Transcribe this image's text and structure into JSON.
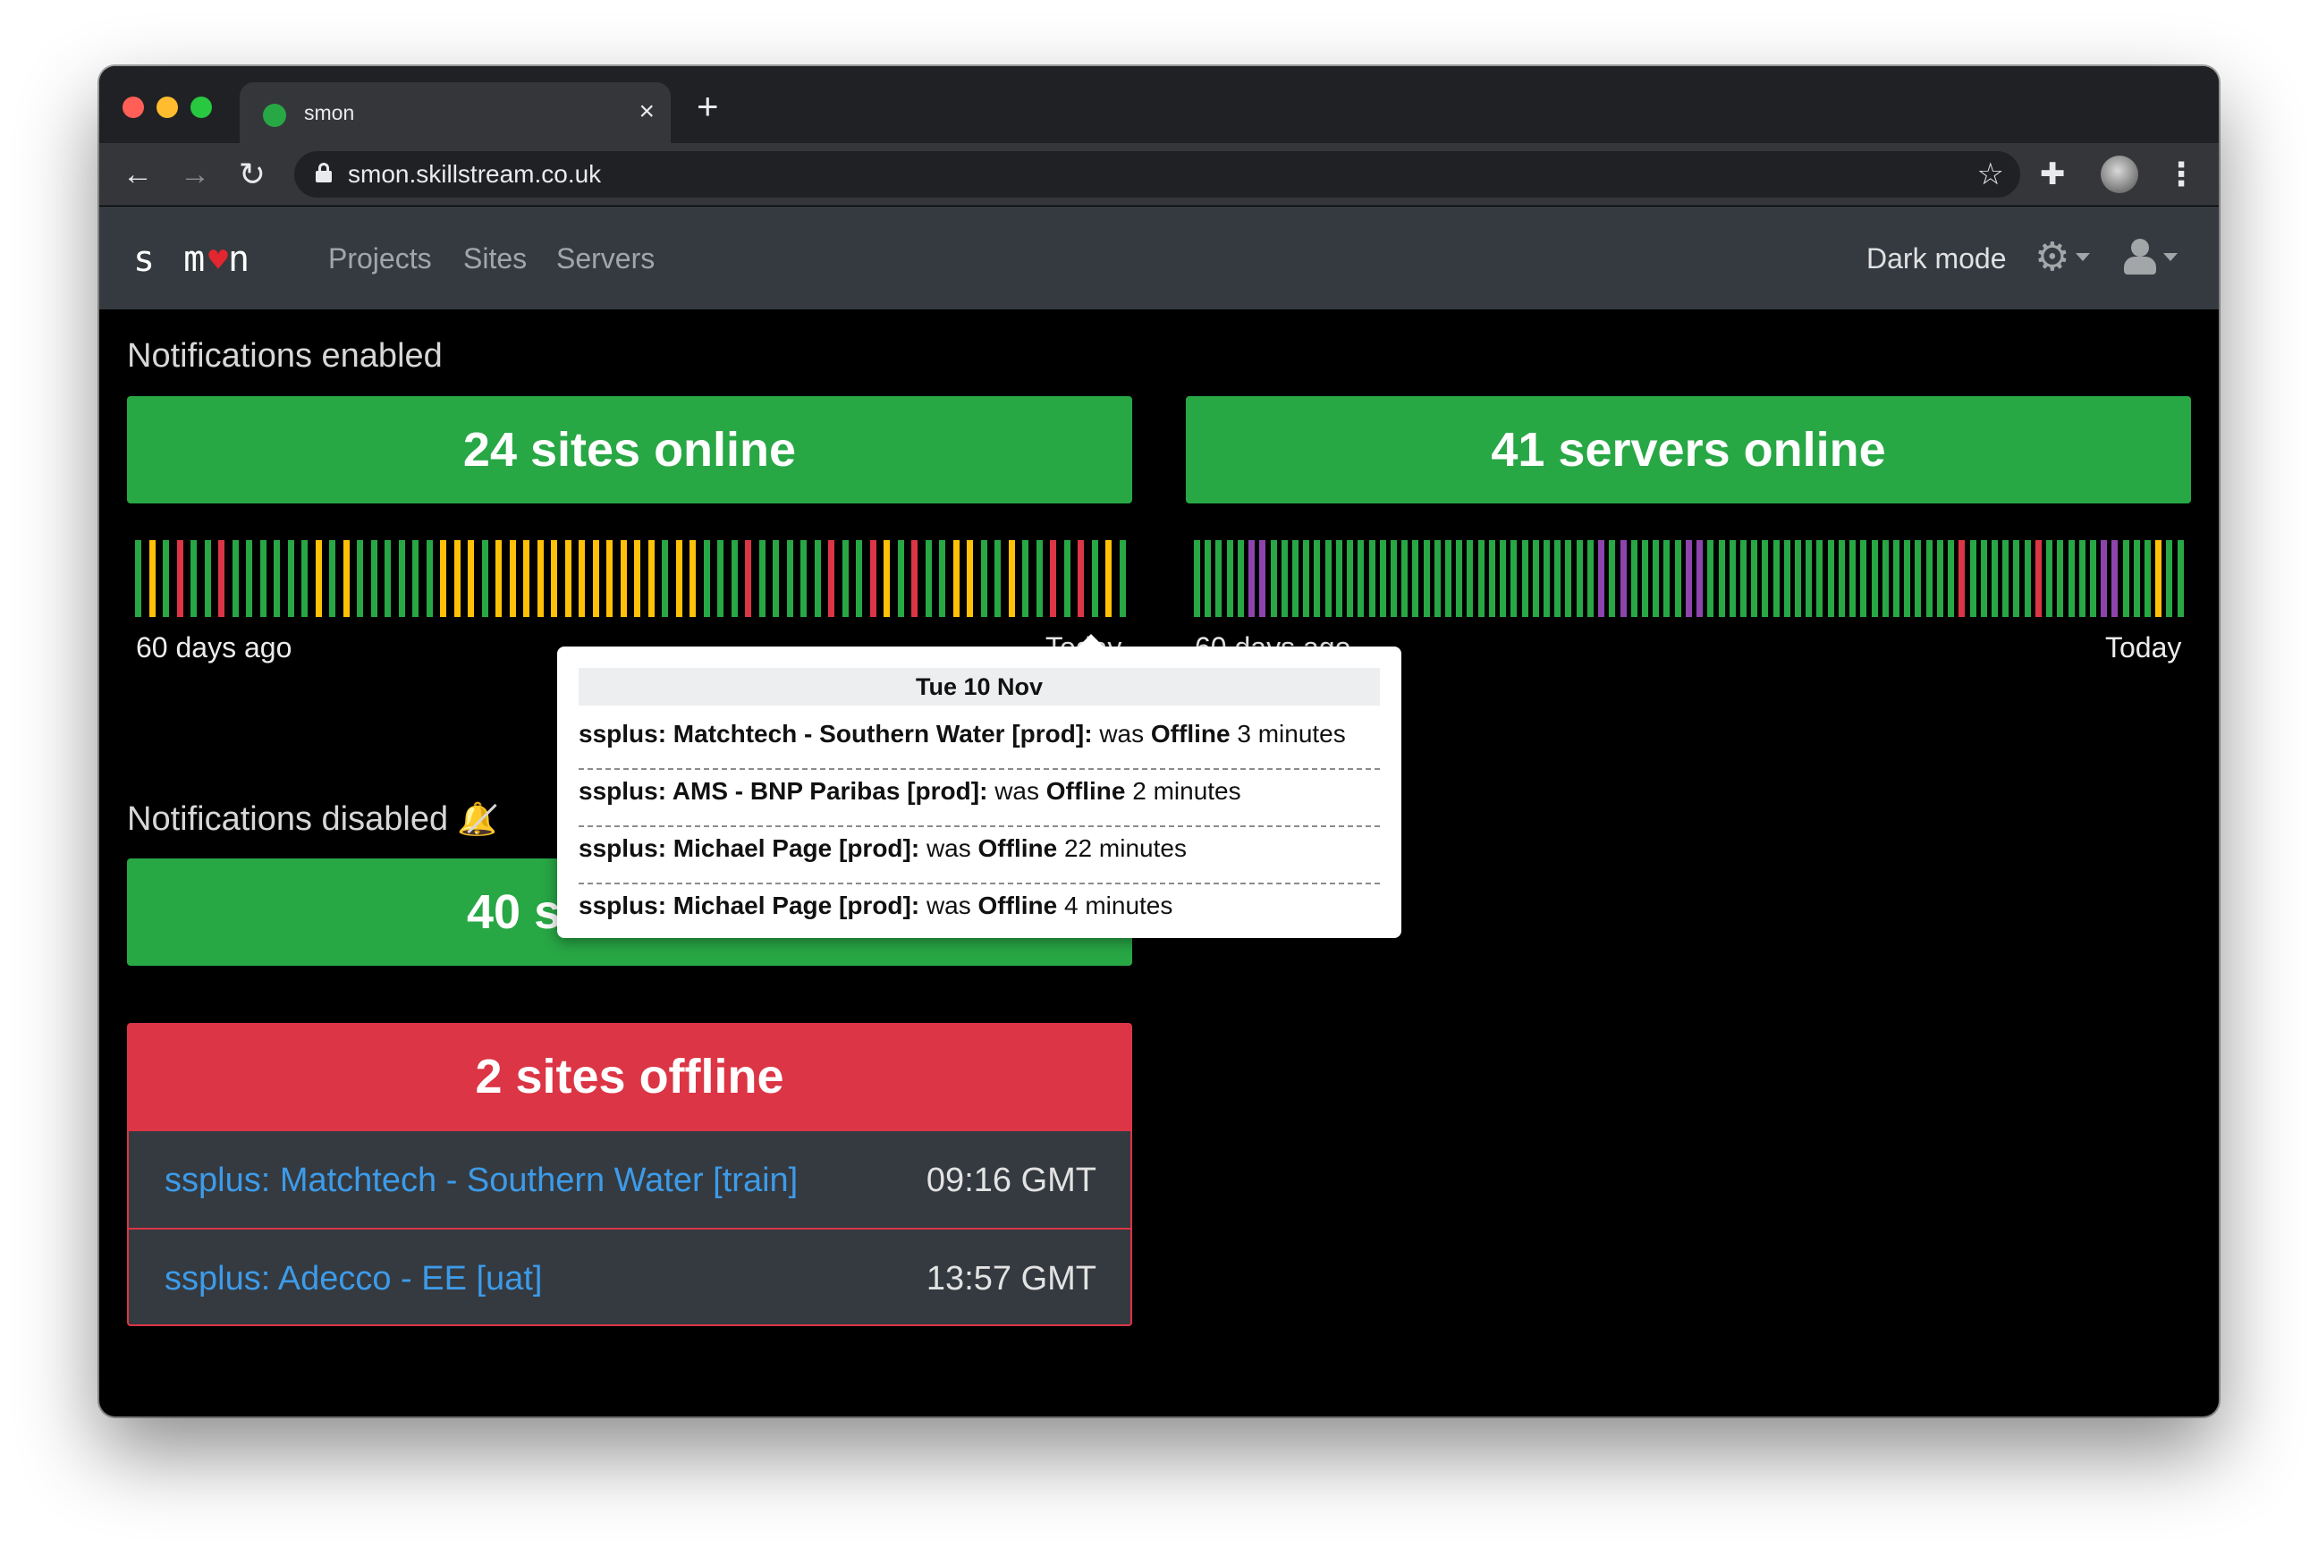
{
  "browser": {
    "tab_title": "smon",
    "tab_close": "×",
    "new_tab": "+",
    "url": "smon.skillstream.co.uk",
    "back": "←",
    "forward": "→",
    "reload": "↻",
    "star": "☆",
    "extensions": "✚",
    "menu": "⋮"
  },
  "navbar": {
    "brand_s": "s m",
    "brand_heart": "♥",
    "brand_n": "n",
    "links": [
      "Projects",
      "Sites",
      "Servers"
    ],
    "dark_mode": "Dark mode",
    "gear": "⚙"
  },
  "notifications_enabled": {
    "title": "Notifications enabled",
    "sites_card": "24 sites online",
    "servers_card": "41 servers online",
    "range_start": "60 days ago",
    "range_end": "Today",
    "sites_bars": [
      "g",
      "y",
      "g",
      "r",
      "g",
      "g",
      "r",
      "g",
      "g",
      "g",
      "g",
      "g",
      "g",
      "y",
      "g",
      "y",
      "g",
      "g",
      "g",
      "g",
      "g",
      "g",
      "y",
      "y",
      "y",
      "g",
      "y",
      "y",
      "y",
      "y",
      "y",
      "y",
      "y",
      "y",
      "y",
      "y",
      "y",
      "y",
      "g",
      "y",
      "y",
      "g",
      "g",
      "g",
      "r",
      "g",
      "g",
      "g",
      "g",
      "g",
      "r",
      "g",
      "g",
      "r",
      "y",
      "g",
      "r",
      "g",
      "g",
      "y",
      "y",
      "g",
      "g",
      "y",
      "g",
      "g",
      "r",
      "g",
      "r",
      "g",
      "y",
      "g"
    ],
    "servers_bars": [
      "g",
      "g",
      "g",
      "g",
      "g",
      "p",
      "p",
      "g",
      "g",
      "g",
      "g",
      "g",
      "g",
      "g",
      "g",
      "g",
      "g",
      "g",
      "g",
      "g",
      "g",
      "g",
      "g",
      "g",
      "g",
      "g",
      "g",
      "g",
      "g",
      "g",
      "g",
      "g",
      "g",
      "g",
      "g",
      "g",
      "g",
      "p",
      "g",
      "p",
      "g",
      "g",
      "g",
      "g",
      "g",
      "p",
      "p",
      "g",
      "g",
      "g",
      "g",
      "g",
      "g",
      "g",
      "g",
      "g",
      "g",
      "g",
      "g",
      "g",
      "g",
      "g",
      "g",
      "g",
      "g",
      "g",
      "g",
      "g",
      "g",
      "g",
      "r",
      "g",
      "g",
      "g",
      "g",
      "g",
      "g",
      "r",
      "g",
      "g",
      "g",
      "g",
      "g",
      "p",
      "p",
      "g",
      "g",
      "g",
      "y",
      "g",
      "g"
    ],
    "colors": {
      "g": "#28a745",
      "y": "#ffc107",
      "r": "#dc3545",
      "p": "#8e44ad"
    }
  },
  "notifications_disabled": {
    "title": "Notifications disabled",
    "bell": "🔔",
    "card": "40 s"
  },
  "offline": {
    "header": "2 sites offline",
    "rows": [
      {
        "name": "ssplus: Matchtech - Southern Water [train]",
        "time": "09:16 GMT"
      },
      {
        "name": "ssplus: Adecco - EE [uat]",
        "time": "13:57 GMT"
      }
    ]
  },
  "tooltip": {
    "date": "Tue 10 Nov",
    "entries": [
      {
        "site": "ssplus: Matchtech - Southern Water [prod]:",
        "was": "was",
        "status": "Offline",
        "duration": "3 minutes"
      },
      {
        "site": "ssplus: AMS - BNP Paribas [prod]:",
        "was": "was",
        "status": "Offline",
        "duration": "2 minutes"
      },
      {
        "site": "ssplus: Michael Page [prod]:",
        "was": "was",
        "status": "Offline",
        "duration": "22 minutes"
      },
      {
        "site": "ssplus: Michael Page [prod]:",
        "was": "was",
        "status": "Offline",
        "duration": "4 minutes"
      }
    ]
  }
}
